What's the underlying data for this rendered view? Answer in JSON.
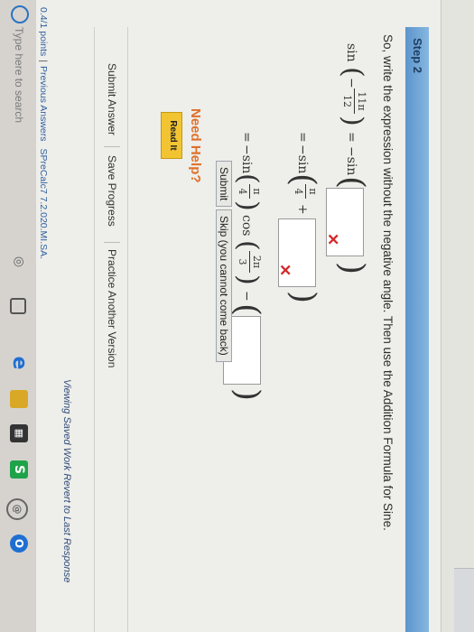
{
  "step": {
    "label": "Step 2",
    "instruction": "So, write the expression without the negative angle. Then use the Addition Formula for Sine."
  },
  "math": {
    "sin": "sin",
    "neg_sin": "−sin",
    "minus": "−",
    "plus": "+",
    "equals": "=",
    "cos": "cos",
    "frac_11pi": {
      "num": "11π",
      "den": "12"
    },
    "frac_pi_4": {
      "num": "π",
      "den": "4"
    },
    "frac_2pi_3": {
      "num": "2π",
      "den": "3"
    },
    "incorrect_mark": "✕"
  },
  "actions": {
    "submit": "Submit",
    "skip": "Skip (you cannot come back)"
  },
  "help": {
    "title": "Need Help?",
    "read_it": "Read It"
  },
  "footer": {
    "submit_answer": "Submit Answer",
    "save_progress": "Save Progress",
    "practice": "Practice Another Version",
    "viewing": "Viewing Saved Work Revert to Last Response"
  },
  "status": {
    "points": "0.4/1 points",
    "previous": "Previous Answers",
    "problem": "SPreCalc7 7.2.020.MI.SA."
  },
  "taskbar": {
    "search_placeholder": "Type here to search"
  },
  "colors": {
    "step_bar": "#6fa4d6",
    "need_help": "#e0702a",
    "read_it": "#f2c431",
    "incorrect": "#d32a2a"
  }
}
